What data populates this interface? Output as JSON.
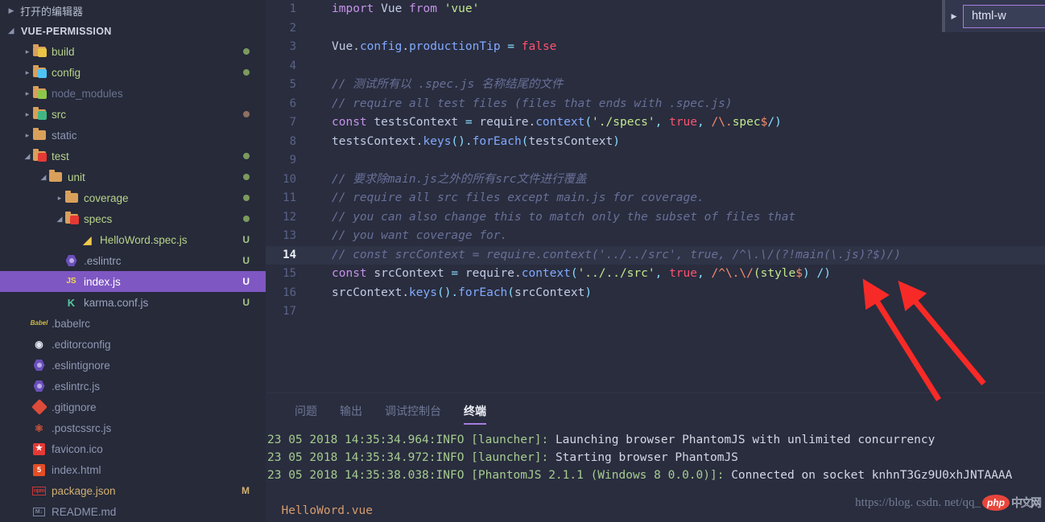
{
  "sidebar": {
    "open_editors_label": "打开的编辑器",
    "project_label": "VUE-PERMISSION",
    "tree": [
      {
        "depth": 1,
        "label": "build",
        "icon": "folder-build-icon",
        "icon_kind": "folder-badge",
        "badge_text": "",
        "badge_color": "#e8c547",
        "color": "#b8d38a",
        "twisty": "collapsed",
        "status": "",
        "dot": "#7c9a5d"
      },
      {
        "depth": 1,
        "label": "config",
        "icon": "folder-config-icon",
        "icon_kind": "folder-badge",
        "badge_text": "",
        "badge_color": "#4fc3f7",
        "color": "#b8d38a",
        "twisty": "collapsed",
        "status": "",
        "dot": "#7c9a5d"
      },
      {
        "depth": 1,
        "label": "node_modules",
        "icon": "folder-node-icon",
        "icon_kind": "folder-badge",
        "badge_text": "",
        "badge_color": "#8cc84b",
        "color": "#6b7390",
        "twisty": "collapsed",
        "status": "",
        "dot": ""
      },
      {
        "depth": 1,
        "label": "src",
        "icon": "folder-src-icon",
        "icon_kind": "folder-badge",
        "badge_text": "",
        "badge_color": "#41b883",
        "color": "#b8d38a",
        "twisty": "collapsed",
        "status": "",
        "dot": "#8d7062"
      },
      {
        "depth": 1,
        "label": "static",
        "icon": "folder-icon",
        "icon_kind": "folder",
        "badge_text": "",
        "badge_color": "",
        "color": "#8f97b2",
        "twisty": "collapsed",
        "status": "",
        "dot": ""
      },
      {
        "depth": 1,
        "label": "test",
        "icon": "folder-test-icon",
        "icon_kind": "folder-badge",
        "badge_text": "",
        "badge_color": "#e53935",
        "color": "#b8d38a",
        "twisty": "expanded",
        "status": "",
        "dot": "#7c9a5d"
      },
      {
        "depth": 2,
        "label": "unit",
        "icon": "folder-icon",
        "icon_kind": "folder",
        "badge_text": "",
        "badge_color": "",
        "color": "#b8d38a",
        "twisty": "expanded",
        "status": "",
        "dot": "#7c9a5d"
      },
      {
        "depth": 3,
        "label": "coverage",
        "icon": "folder-icon",
        "icon_kind": "folder",
        "badge_text": "",
        "badge_color": "",
        "color": "#b8d38a",
        "twisty": "collapsed",
        "status": "",
        "dot": "#7c9a5d"
      },
      {
        "depth": 3,
        "label": "specs",
        "icon": "folder-test-icon",
        "icon_kind": "folder-badge",
        "badge_text": "",
        "badge_color": "#e53935",
        "color": "#b8d38a",
        "twisty": "expanded",
        "status": "",
        "dot": "#7c9a5d"
      },
      {
        "depth": 4,
        "label": "HelloWord.spec.js",
        "icon": "test-file-icon",
        "icon_kind": "tri",
        "badge_text": "",
        "badge_color": "#f2c94c",
        "color": "#b8d38a",
        "twisty": "none",
        "status": "U",
        "dot": ""
      },
      {
        "depth": 3,
        "label": ".eslintrc",
        "icon": "eslint-icon",
        "icon_kind": "hex",
        "badge_text": "",
        "badge_color": "",
        "color": "#9aa3bd",
        "twisty": "none",
        "status": "U",
        "dot": ""
      },
      {
        "depth": 3,
        "label": "index.js",
        "icon": "javascript-icon",
        "icon_kind": "js",
        "badge_text": "JS",
        "badge_color": "#f0db4f",
        "color": "#ffffff",
        "twisty": "none",
        "status": "U",
        "dot": "",
        "selected": true
      },
      {
        "depth": 3,
        "label": "karma.conf.js",
        "icon": "karma-icon",
        "icon_kind": "karma",
        "badge_text": "K",
        "badge_color": "#56c8a0",
        "color": "#9aa3bd",
        "twisty": "none",
        "status": "U",
        "dot": ""
      },
      {
        "depth": 1,
        "label": ".babelrc",
        "icon": "babel-icon",
        "icon_kind": "babel",
        "badge_text": "",
        "badge_color": "#f5da55",
        "color": "#8f97b2",
        "twisty": "none",
        "status": "",
        "dot": ""
      },
      {
        "depth": 1,
        "label": ".editorconfig",
        "icon": "editorconfig-icon",
        "icon_kind": "editorconfig",
        "badge_text": "",
        "badge_color": "#e8edf5",
        "color": "#8f97b2",
        "twisty": "none",
        "status": "",
        "dot": ""
      },
      {
        "depth": 1,
        "label": ".eslintignore",
        "icon": "eslint-icon",
        "icon_kind": "hex",
        "badge_text": "",
        "badge_color": "",
        "color": "#8f97b2",
        "twisty": "none",
        "status": "",
        "dot": ""
      },
      {
        "depth": 1,
        "label": ".eslintrc.js",
        "icon": "eslint-icon",
        "icon_kind": "hex",
        "badge_text": "",
        "badge_color": "",
        "color": "#8f97b2",
        "twisty": "none",
        "status": "",
        "dot": ""
      },
      {
        "depth": 1,
        "label": ".gitignore",
        "icon": "git-icon",
        "icon_kind": "diamond",
        "badge_text": "",
        "badge_color": "#dd4b39",
        "color": "#8f97b2",
        "twisty": "none",
        "status": "",
        "dot": ""
      },
      {
        "depth": 1,
        "label": ".postcssrc.js",
        "icon": "postcss-icon",
        "icon_kind": "postcss",
        "badge_text": "",
        "badge_color": "#dd3a0a",
        "color": "#8f97b2",
        "twisty": "none",
        "status": "",
        "dot": ""
      },
      {
        "depth": 1,
        "label": "favicon.ico",
        "icon": "favicon-icon",
        "icon_kind": "favicon",
        "badge_text": "★",
        "badge_color": "#e53935",
        "color": "#8f97b2",
        "twisty": "none",
        "status": "",
        "dot": ""
      },
      {
        "depth": 1,
        "label": "index.html",
        "icon": "html5-icon",
        "icon_kind": "html",
        "badge_text": "5",
        "badge_color": "#e44d26",
        "color": "#8f97b2",
        "twisty": "none",
        "status": "",
        "dot": ""
      },
      {
        "depth": 1,
        "label": "package.json",
        "icon": "npm-icon",
        "icon_kind": "npm",
        "badge_text": "npm",
        "badge_color": "#cb3837",
        "color": "#d3b072",
        "twisty": "none",
        "status": "M",
        "dot": ""
      },
      {
        "depth": 1,
        "label": "README.md",
        "icon": "markdown-icon",
        "icon_kind": "md",
        "badge_text": "M↓",
        "badge_color": "#8f97b2",
        "color": "#8f97b2",
        "twisty": "none",
        "status": "",
        "dot": ""
      }
    ]
  },
  "overlay_widget": {
    "twisty_icon": "chevron-right-icon",
    "text": "html-w"
  },
  "editor": {
    "current_line": 14,
    "lines": [
      {
        "n": 1,
        "tokens": [
          {
            "t": "import ",
            "c": "t-kw"
          },
          {
            "t": "Vue ",
            "c": "t-var"
          },
          {
            "t": "from ",
            "c": "t-kw"
          },
          {
            "t": "'vue'",
            "c": "t-str"
          }
        ]
      },
      {
        "n": 2,
        "tokens": []
      },
      {
        "n": 3,
        "tokens": [
          {
            "t": "Vue",
            "c": "t-var"
          },
          {
            "t": ".",
            "c": "t-plain"
          },
          {
            "t": "config",
            "c": "t-prop"
          },
          {
            "t": ".",
            "c": "t-plain"
          },
          {
            "t": "productionTip ",
            "c": "t-prop"
          },
          {
            "t": "= ",
            "c": "t-punc"
          },
          {
            "t": "false",
            "c": "t-bool"
          }
        ]
      },
      {
        "n": 4,
        "tokens": []
      },
      {
        "n": 5,
        "tokens": [
          {
            "t": "// 测试所有以 .spec.js 名称结尾的文件",
            "c": "t-cmt"
          }
        ]
      },
      {
        "n": 6,
        "tokens": [
          {
            "t": "// require all test files (files that ends with .spec.js)",
            "c": "t-cmt"
          }
        ]
      },
      {
        "n": 7,
        "tokens": [
          {
            "t": "const ",
            "c": "t-kw"
          },
          {
            "t": "testsContext ",
            "c": "t-var"
          },
          {
            "t": "= ",
            "c": "t-punc"
          },
          {
            "t": "require",
            "c": "t-var"
          },
          {
            "t": ".",
            "c": "t-plain"
          },
          {
            "t": "context",
            "c": "t-prop"
          },
          {
            "t": "(",
            "c": "t-punc"
          },
          {
            "t": "'./specs'",
            "c": "t-str"
          },
          {
            "t": ", ",
            "c": "t-punc"
          },
          {
            "t": "true",
            "c": "t-bool"
          },
          {
            "t": ", ",
            "c": "t-punc"
          },
          {
            "t": "/",
            "c": "t-rx"
          },
          {
            "t": "\\.",
            "c": "t-rx"
          },
          {
            "t": "spec",
            "c": "t-rx2"
          },
          {
            "t": "$",
            "c": "t-rx"
          },
          {
            "t": "/)",
            "c": "t-punc"
          }
        ]
      },
      {
        "n": 8,
        "tokens": [
          {
            "t": "testsContext",
            "c": "t-var"
          },
          {
            "t": ".",
            "c": "t-plain"
          },
          {
            "t": "keys",
            "c": "t-prop"
          },
          {
            "t": "().",
            "c": "t-punc"
          },
          {
            "t": "forEach",
            "c": "t-prop"
          },
          {
            "t": "(",
            "c": "t-punc"
          },
          {
            "t": "testsContext",
            "c": "t-var"
          },
          {
            "t": ")",
            "c": "t-punc"
          }
        ]
      },
      {
        "n": 9,
        "tokens": []
      },
      {
        "n": 10,
        "tokens": [
          {
            "t": "// 要求除main.js之外的所有src文件进行覆盖",
            "c": "t-cmt"
          }
        ]
      },
      {
        "n": 11,
        "tokens": [
          {
            "t": "// require all src files except main.js for coverage.",
            "c": "t-cmt"
          }
        ]
      },
      {
        "n": 12,
        "tokens": [
          {
            "t": "// you can also change this to match only the subset of files that",
            "c": "t-cmt"
          }
        ]
      },
      {
        "n": 13,
        "tokens": [
          {
            "t": "// you want coverage for.",
            "c": "t-cmt"
          }
        ]
      },
      {
        "n": 14,
        "tokens": [
          {
            "t": "// const srcContext = require.context('../../src', true, /^\\.\\/(?!main(\\.js)?$)/)",
            "c": "t-cmt"
          }
        ]
      },
      {
        "n": 15,
        "tokens": [
          {
            "t": "const ",
            "c": "t-kw"
          },
          {
            "t": "srcContext ",
            "c": "t-var"
          },
          {
            "t": "= ",
            "c": "t-punc"
          },
          {
            "t": "require",
            "c": "t-var"
          },
          {
            "t": ".",
            "c": "t-plain"
          },
          {
            "t": "context",
            "c": "t-prop"
          },
          {
            "t": "(",
            "c": "t-punc"
          },
          {
            "t": "'../../src'",
            "c": "t-str"
          },
          {
            "t": ", ",
            "c": "t-punc"
          },
          {
            "t": "true",
            "c": "t-bool"
          },
          {
            "t": ", ",
            "c": "t-punc"
          },
          {
            "t": "/",
            "c": "t-rx"
          },
          {
            "t": "^",
            "c": "t-rx"
          },
          {
            "t": "\\.",
            "c": "t-rx"
          },
          {
            "t": "\\/",
            "c": "t-rx"
          },
          {
            "t": "(style",
            "c": "t-rx2"
          },
          {
            "t": "$",
            "c": "t-rx"
          },
          {
            "t": ") /)",
            "c": "t-punc"
          }
        ]
      },
      {
        "n": 16,
        "tokens": [
          {
            "t": "srcContext",
            "c": "t-var"
          },
          {
            "t": ".",
            "c": "t-plain"
          },
          {
            "t": "keys",
            "c": "t-prop"
          },
          {
            "t": "().",
            "c": "t-punc"
          },
          {
            "t": "forEach",
            "c": "t-prop"
          },
          {
            "t": "(",
            "c": "t-punc"
          },
          {
            "t": "srcContext",
            "c": "t-var"
          },
          {
            "t": ")",
            "c": "t-punc"
          }
        ]
      },
      {
        "n": 17,
        "tokens": []
      }
    ]
  },
  "panel": {
    "tabs": [
      {
        "label": "问题",
        "active": false
      },
      {
        "label": "输出",
        "active": false
      },
      {
        "label": "调试控制台",
        "active": false
      },
      {
        "label": "终端",
        "active": true
      }
    ],
    "terminal_lines": [
      {
        "segments": [
          {
            "t": "23 05 2018 14:35:34.964:INFO ",
            "c": "g-date"
          },
          {
            "t": "[launcher]: ",
            "c": "g-tag"
          },
          {
            "t": "Launching browser PhantomJS with unlimited concurrency",
            "c": "g-txt"
          }
        ]
      },
      {
        "segments": [
          {
            "t": "23 05 2018 14:35:34.972:INFO ",
            "c": "g-date"
          },
          {
            "t": "[launcher]: ",
            "c": "g-tag"
          },
          {
            "t": "Starting browser PhantomJS",
            "c": "g-txt"
          }
        ]
      },
      {
        "segments": [
          {
            "t": "23 05 2018 14:35:38.038:INFO ",
            "c": "g-date"
          },
          {
            "t": "[PhantomJS 2.1.1 (Windows 8 0.0.0)]: ",
            "c": "g-tag"
          },
          {
            "t": "Connected on socket knhnT3Gz9U0xhJNTAAAA",
            "c": "g-txt"
          }
        ]
      },
      {
        "segments": []
      },
      {
        "segments": [
          {
            "t": "  HelloWord.vue",
            "c": "g-file"
          }
        ]
      }
    ]
  },
  "watermark": {
    "url": "https://blog. csdn. net/qq_",
    "badge": "php",
    "cn": "中文网"
  },
  "colors": {
    "editor_bg": "#292d3e",
    "sidebar_bg": "#262a39",
    "selection_purple": "#7e57c2",
    "accent_underline": "#a77ce0",
    "arrow_red": "#f82a27",
    "current_line_bg": "#2f3447"
  }
}
